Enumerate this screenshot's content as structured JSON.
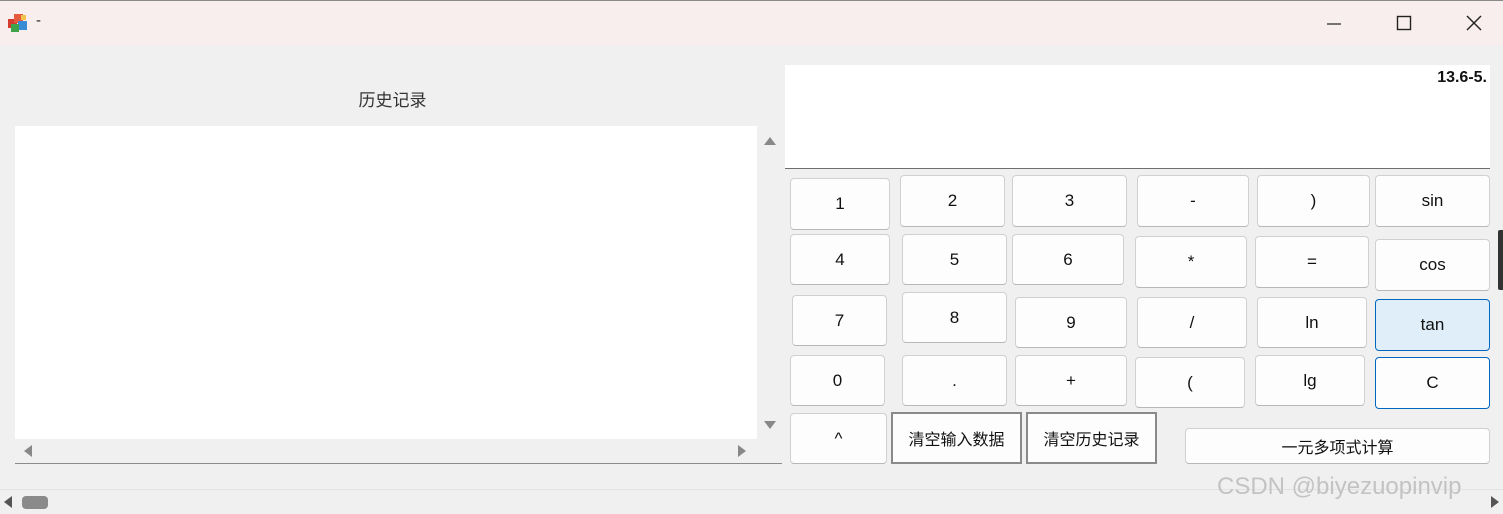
{
  "window": {
    "title": "-",
    "icon": "app-cube-icon"
  },
  "history": {
    "title": "历史记录",
    "items": []
  },
  "display": {
    "text": "13.6-5."
  },
  "keys": {
    "k1": "1",
    "k2": "2",
    "k3": "3",
    "minus": "-",
    "rparen": ")",
    "sin": "sin",
    "k4": "4",
    "k5": "5",
    "k6": "6",
    "times": "*",
    "equals": "=",
    "cos": "cos",
    "k7": "7",
    "k8": "8",
    "k9": "9",
    "divide": "/",
    "ln": "ln",
    "tan": "tan",
    "k0": "0",
    "dot": ".",
    "plus": "+",
    "lparen": "(",
    "lg": "lg",
    "clear": "C",
    "power": "^",
    "clear_input": "清空输入数据",
    "clear_history": "清空历史记录",
    "polynomial": "一元多项式计算"
  },
  "watermark": "CSDN @biyezuopinvip",
  "colors": {
    "accent": "#0067c0",
    "hover_fill": "#e0eef9",
    "titlebar": "#f8eeed"
  }
}
